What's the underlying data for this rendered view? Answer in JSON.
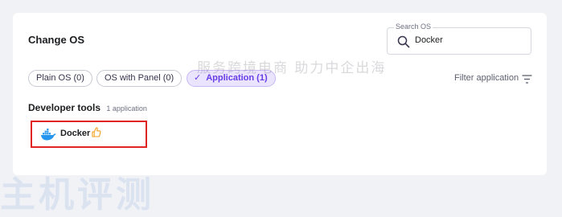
{
  "page_title": "Change OS",
  "search": {
    "label": "Search OS",
    "value": "Docker",
    "icon": "search-icon"
  },
  "filters": [
    {
      "label": "Plain OS (0)",
      "active": false
    },
    {
      "label": "OS with Panel (0)",
      "active": false
    },
    {
      "label": "Application (1)",
      "active": true
    }
  ],
  "filter_application_label": "Filter application",
  "section": {
    "title": "Developer tools",
    "count": "1 application"
  },
  "apps": [
    {
      "name": "Docker",
      "icon": "docker-icon",
      "badge_icon": "thumbs-up-icon"
    }
  ],
  "watermark": {
    "main": "主机评测",
    "sub": "服务跨境电商 助力中企出海",
    "bottom": "主机评测"
  },
  "colors": {
    "accent": "#673de6",
    "accent_bg": "#ebe4ff",
    "highlight_border": "#e02424",
    "docker_blue": "#2496ed",
    "thumb_orange": "#f0a020"
  }
}
